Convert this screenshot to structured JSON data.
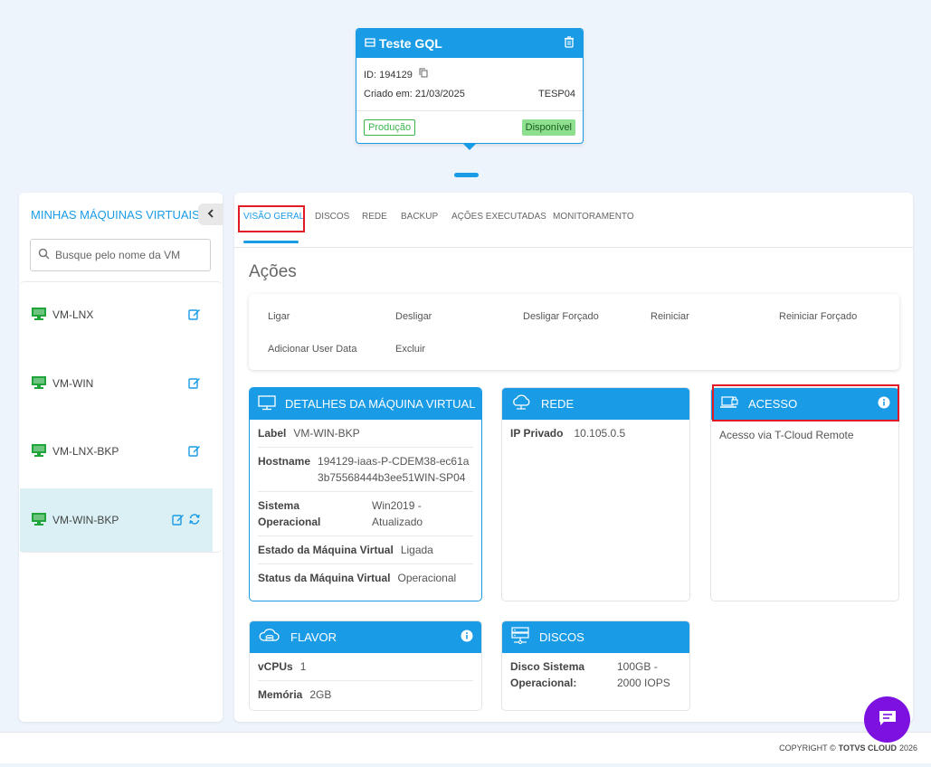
{
  "vm_card": {
    "title": "Teste GQL",
    "id_label": "ID: 194129",
    "created_label": "Criado em: 21/03/2025",
    "location": "TESP04",
    "env_badge": "Produção",
    "status_badge": "Disponível"
  },
  "sidebar": {
    "title": "MINHAS MÁQUINAS VIRTUAIS",
    "search_placeholder": "Busque pelo nome da VM",
    "items": [
      {
        "label": "VM-LNX"
      },
      {
        "label": "VM-WIN"
      },
      {
        "label": "VM-LNX-BKP"
      },
      {
        "label": "VM-WIN-BKP"
      }
    ]
  },
  "tabs": [
    {
      "label": "VISÃO GERAL"
    },
    {
      "label": "DISCOS"
    },
    {
      "label": "REDE"
    },
    {
      "label": "BACKUP"
    },
    {
      "label": "AÇÕES EXECUTADAS"
    },
    {
      "label": "MONITORAMENTO"
    }
  ],
  "actions": {
    "title": "Ações",
    "items": [
      "Ligar",
      "Desligar",
      "Desligar Forçado",
      "Reiniciar",
      "Reiniciar Forçado",
      "Adicionar User Data",
      "Excluir"
    ]
  },
  "details": {
    "title": "DETALHES DA MÁQUINA VIRTUAL",
    "rows": [
      {
        "k": "Label",
        "v": "VM-WIN-BKP"
      },
      {
        "k": "Hostname",
        "v": "194129-iaas-P-CDEM38-ec61a3b75568444b3ee51WIN-SP04"
      },
      {
        "k": "Sistema Operacional",
        "v": "Win2019 - Atualizado"
      },
      {
        "k": "Estado da Máquina Virtual",
        "v": "Ligada"
      },
      {
        "k": "Status da Máquina Virtual",
        "v": "Operacional"
      }
    ]
  },
  "rede": {
    "title": "REDE",
    "rows": [
      {
        "k": "IP Privado",
        "v": "10.105.0.5"
      }
    ]
  },
  "acesso": {
    "title": "ACESSO",
    "text": "Acesso via T-Cloud Remote"
  },
  "flavor": {
    "title": "FLAVOR",
    "rows": [
      {
        "k": "vCPUs",
        "v": "1"
      },
      {
        "k": "Memória",
        "v": "2GB"
      }
    ]
  },
  "discos": {
    "title": "DISCOS",
    "rows": [
      {
        "k": "Disco Sistema Operacional:",
        "v": "100GB - 2000 IOPS"
      }
    ]
  },
  "footer": {
    "copyright": "COPYRIGHT ©",
    "brand": "TOTVS CLOUD",
    "year": "2026"
  },
  "colors": {
    "primary": "#1a9be6",
    "highlight": "#e01b24",
    "vm_icon": "#1fa53a",
    "chat": "#7d11e0"
  }
}
